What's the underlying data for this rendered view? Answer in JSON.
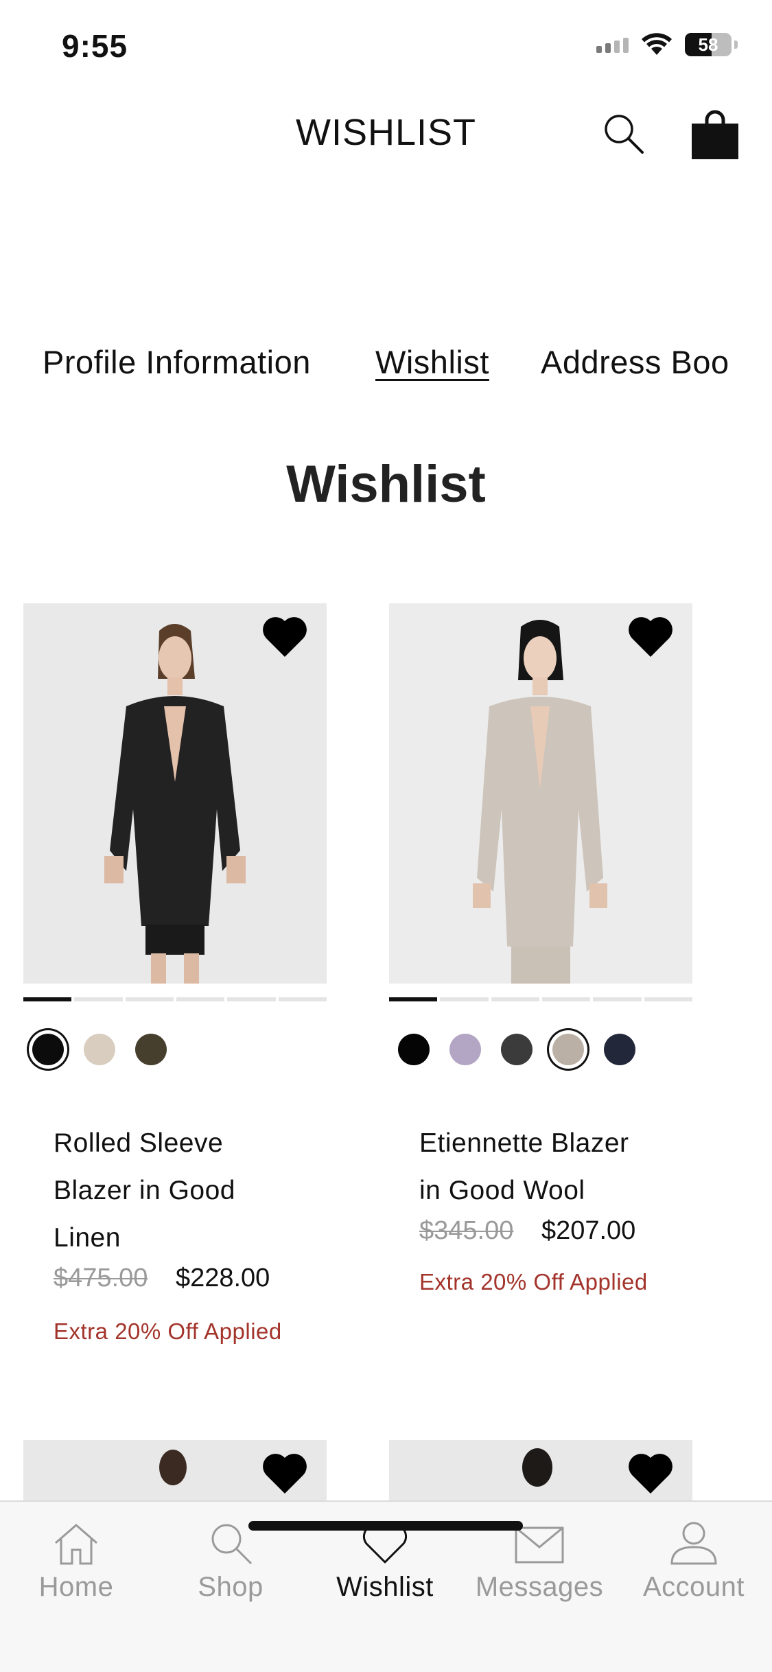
{
  "status_bar": {
    "time": "9:55",
    "battery_percent": "58",
    "battery_level": 0.58,
    "icons": [
      "cellular-signal-icon",
      "wifi-icon",
      "battery-icon"
    ]
  },
  "header": {
    "title": "WISHLIST",
    "icons": [
      "search-icon",
      "shopping-bag-icon"
    ]
  },
  "account_tabs": {
    "items": [
      {
        "label": "Profile Information",
        "active": false
      },
      {
        "label": "Wishlist",
        "active": true
      },
      {
        "label": "Address Boo",
        "active": false
      }
    ]
  },
  "page": {
    "title": "Wishlist"
  },
  "products": [
    {
      "name_lines": [
        "Rolled Sleeve",
        "Blazer in Good",
        "Linen"
      ],
      "original_price": "$475.00",
      "sale_price": "$228.00",
      "promo": "Extra 20% Off Applied",
      "wishlisted": true,
      "image_slide_count": 6,
      "image_slide_active": 1,
      "colors": [
        "#0c0c0c",
        "#d9cdbf",
        "#463f2e"
      ],
      "selected_color_index": 0
    },
    {
      "name_lines": [
        "Etiennette Blazer",
        "in Good Wool"
      ],
      "original_price": "$345.00",
      "sale_price": "$207.00",
      "promo": "Extra 20% Off Applied",
      "wishlisted": true,
      "image_slide_count": 6,
      "image_slide_active": 1,
      "colors": [
        "#050505",
        "#b3a5c4",
        "#3b3b3c",
        "#bbb0a5",
        "#23273a"
      ],
      "selected_color_index": 3
    }
  ],
  "bottom_nav": {
    "items": [
      {
        "label": "Home",
        "icon": "home-icon",
        "active": false
      },
      {
        "label": "Shop",
        "icon": "search-icon",
        "active": false
      },
      {
        "label": "Wishlist",
        "icon": "heart-icon",
        "active": true
      },
      {
        "label": "Messages",
        "icon": "envelope-icon",
        "active": false
      },
      {
        "label": "Account",
        "icon": "user-icon",
        "active": false
      }
    ]
  },
  "colors": {
    "promo": "#a3342b",
    "strike_price": "#9a9a9a",
    "text": "#111111",
    "nav_inactive": "#9a9a9a"
  }
}
